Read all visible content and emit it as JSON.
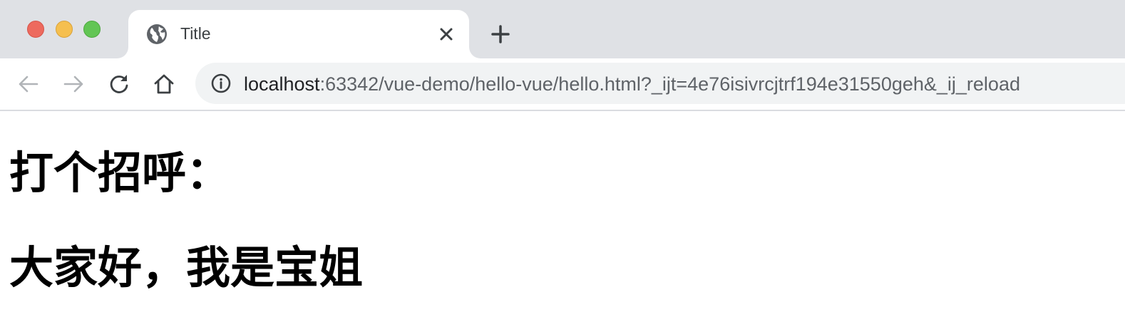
{
  "window": {
    "traffic_lights": {
      "close_color": "#ed6a5e",
      "minimize_color": "#f5bf4f",
      "maximize_color": "#62c554"
    }
  },
  "tabs": [
    {
      "title": "Title",
      "favicon": "globe-icon",
      "close_icon": "close-icon",
      "active": true
    }
  ],
  "new_tab_icon": "plus-icon",
  "toolbar": {
    "back_icon": "arrow-left-icon",
    "forward_icon": "arrow-right-icon",
    "reload_icon": "reload-icon",
    "home_icon": "home-icon"
  },
  "address_bar": {
    "site_info_icon": "info-icon",
    "host": "localhost",
    "rest": ":63342/vue-demo/hello-vue/hello.html?_ijt=4e76isivrcjtrf194e31550geh&_ij_reload"
  },
  "page": {
    "greeting_heading": "打个招呼：",
    "message_heading": "大家好，我是宝姐"
  }
}
